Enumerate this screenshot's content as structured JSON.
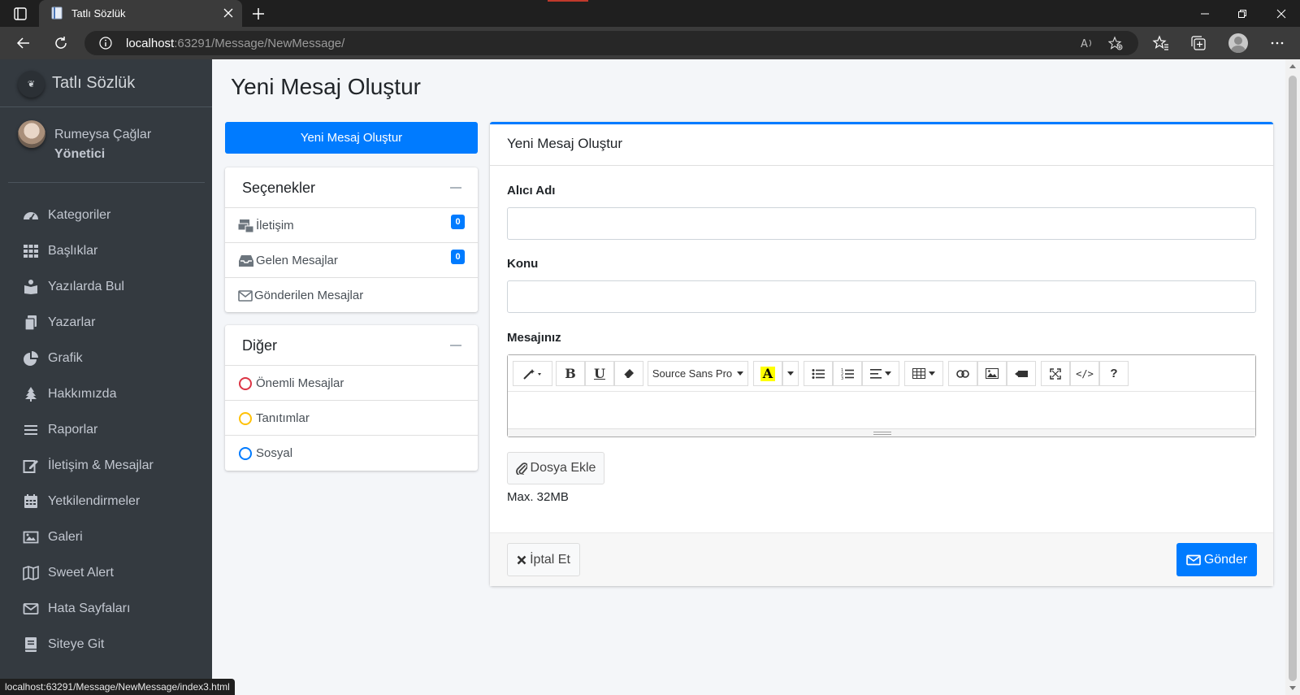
{
  "browser": {
    "tab_title": "Tatlı Sözlük",
    "url_host": "localhost",
    "url_rest": ":63291/Message/NewMessage/",
    "status_url": "localhost:63291/Message/NewMessage/index3.html"
  },
  "sidebar": {
    "brand": "Tatlı Sözlük",
    "user_name": "Rumeysa Çağlar",
    "user_role": "Yönetici",
    "items": [
      {
        "label": "Kategoriler",
        "icon": "dashboard-gauge-icon"
      },
      {
        "label": "Başlıklar",
        "icon": "grid-icon"
      },
      {
        "label": "Yazılarda Bul",
        "icon": "book-reader-icon"
      },
      {
        "label": "Yazarlar",
        "icon": "copy-icon"
      },
      {
        "label": "Grafik",
        "icon": "pie-chart-icon"
      },
      {
        "label": "Hakkımızda",
        "icon": "tree-icon"
      },
      {
        "label": "Raporlar",
        "icon": "list-icon"
      },
      {
        "label": "İletişim & Mesajlar",
        "icon": "edit-icon"
      },
      {
        "label": "Yetkilendirmeler",
        "icon": "calendar-icon"
      },
      {
        "label": "Galeri",
        "icon": "image-icon"
      },
      {
        "label": "Sweet Alert",
        "icon": "map-icon"
      },
      {
        "label": "Hata Sayfaları",
        "icon": "envelope-icon"
      },
      {
        "label": "Siteye Git",
        "icon": "book-icon"
      }
    ]
  },
  "page": {
    "title": "Yeni Mesaj Oluştur",
    "new_message_button": "Yeni Mesaj Oluştur"
  },
  "options_card": {
    "title": "Seçenekler",
    "items": [
      {
        "label": "İletişim",
        "badge": "0"
      },
      {
        "label": "Gelen Mesajlar",
        "badge": "0"
      },
      {
        "label": "Gönderilen Mesajlar"
      }
    ]
  },
  "other_card": {
    "title": "Diğer",
    "items": [
      {
        "label": "Önemli Mesajlar",
        "color": "#dc3545"
      },
      {
        "label": "Tanıtımlar",
        "color": "#ffc107"
      },
      {
        "label": "Sosyal",
        "color": "#007bff"
      }
    ]
  },
  "form": {
    "card_title": "Yeni Mesaj Oluştur",
    "recipient_label": "Alıcı Adı",
    "recipient_value": "",
    "subject_label": "Konu",
    "subject_value": "",
    "message_label": "Mesajınız",
    "font_select": "Source Sans Pro",
    "attach_label": "Dosya Ekle",
    "max_size": "Max. 32MB",
    "cancel_label": "İptal Et",
    "send_label": "Gönder"
  },
  "colors": {
    "primary": "#007bff",
    "sidebar_bg": "#343a40",
    "content_bg": "#f4f6f9"
  }
}
